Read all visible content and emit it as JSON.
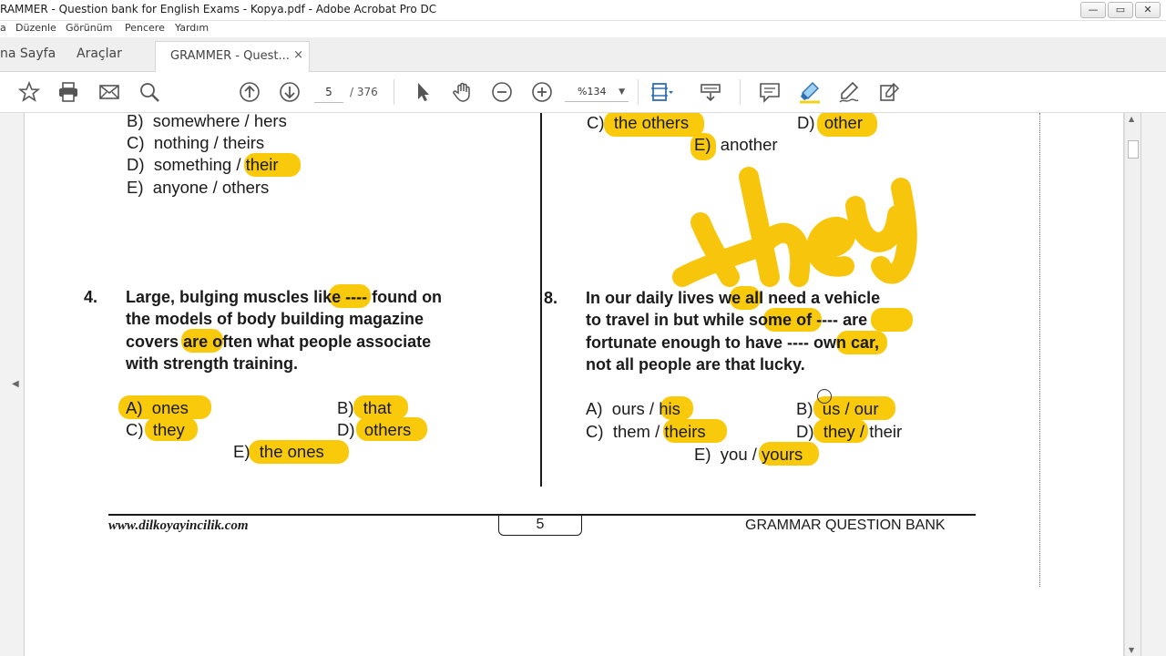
{
  "window": {
    "title": "RAMMER - Question bank for English Exams - Kopya.pdf - Adobe Acrobat Pro DC",
    "minimize": "—",
    "maximize": "▭",
    "close": "✕"
  },
  "menu": [
    "a",
    "Düzenle",
    "Görünüm",
    "Pencere",
    "Yardım"
  ],
  "tabs": {
    "home": "na Sayfa",
    "tools": "Araçlar",
    "document": "GRAMMER - Quest...",
    "close": "×"
  },
  "toolbar": {
    "current_page": "5",
    "total_pages": "/ 376",
    "zoom": "%134",
    "zoom_caret": "▼"
  },
  "document": {
    "left_top_options": [
      {
        "letter": "B)",
        "text": "somewhere / hers"
      },
      {
        "letter": "C)",
        "text": "nothing / theirs"
      },
      {
        "letter": "D)",
        "text": "something",
        "hl": "/ their"
      },
      {
        "letter": "E)",
        "text": "anyone / others"
      }
    ],
    "right_top_options": {
      "c_letter": "C)",
      "c_text": "the others",
      "d_letter": "D)",
      "d_text": "other",
      "e_letter": "E)",
      "e_text": "another"
    },
    "handwriting": "they",
    "q4": {
      "number": "4.",
      "line1_a": "Large, bulging muscles",
      "line1_hl": "like",
      "line1_b": "---- found on",
      "line2": "the models of body building magazine",
      "line3_a": "covers",
      "line3_hl": "are",
      "line3_b": "often what people associate",
      "line4": "with strength training.",
      "a_letter": "A)",
      "a_text": "ones",
      "b_letter": "B)",
      "b_text": "that",
      "c_letter": "C)",
      "c_text": "they",
      "d_letter": "D)",
      "d_text": "others",
      "e_letter": "E)",
      "e_text": "the ones"
    },
    "q8": {
      "number": "8.",
      "line1_a": "In our daily lives",
      "line1_hl": "we",
      "line1_b": "all need a vehicle",
      "line2_a": "to travel in but while",
      "line2_hl": "some",
      "line2_b": "of ----",
      "line2_hl2": "are",
      "line3_a": "fortunate enough to have ----",
      "line3_hl": "own",
      "line3_b": "car,",
      "line4": "not all people are that lucky.",
      "a_letter": "A)",
      "a_text": "ours /",
      "a_hl": "his",
      "b_letter": "B)",
      "b_hl": "us / our",
      "c_letter": "C)",
      "c_text": "them /",
      "c_hl": "theirs",
      "d_letter": "D)",
      "d_hl": "they",
      "d_text": "/ their",
      "e_letter": "E)",
      "e_text": "you /",
      "e_hl": "yours"
    },
    "footer": {
      "site": "www.dilkoyayincilik.com",
      "page": "5",
      "bank": "GRAMMAR QUESTION BANK"
    }
  },
  "colors": {
    "highlight": "#f9c90c",
    "ink": "#f7c400"
  }
}
